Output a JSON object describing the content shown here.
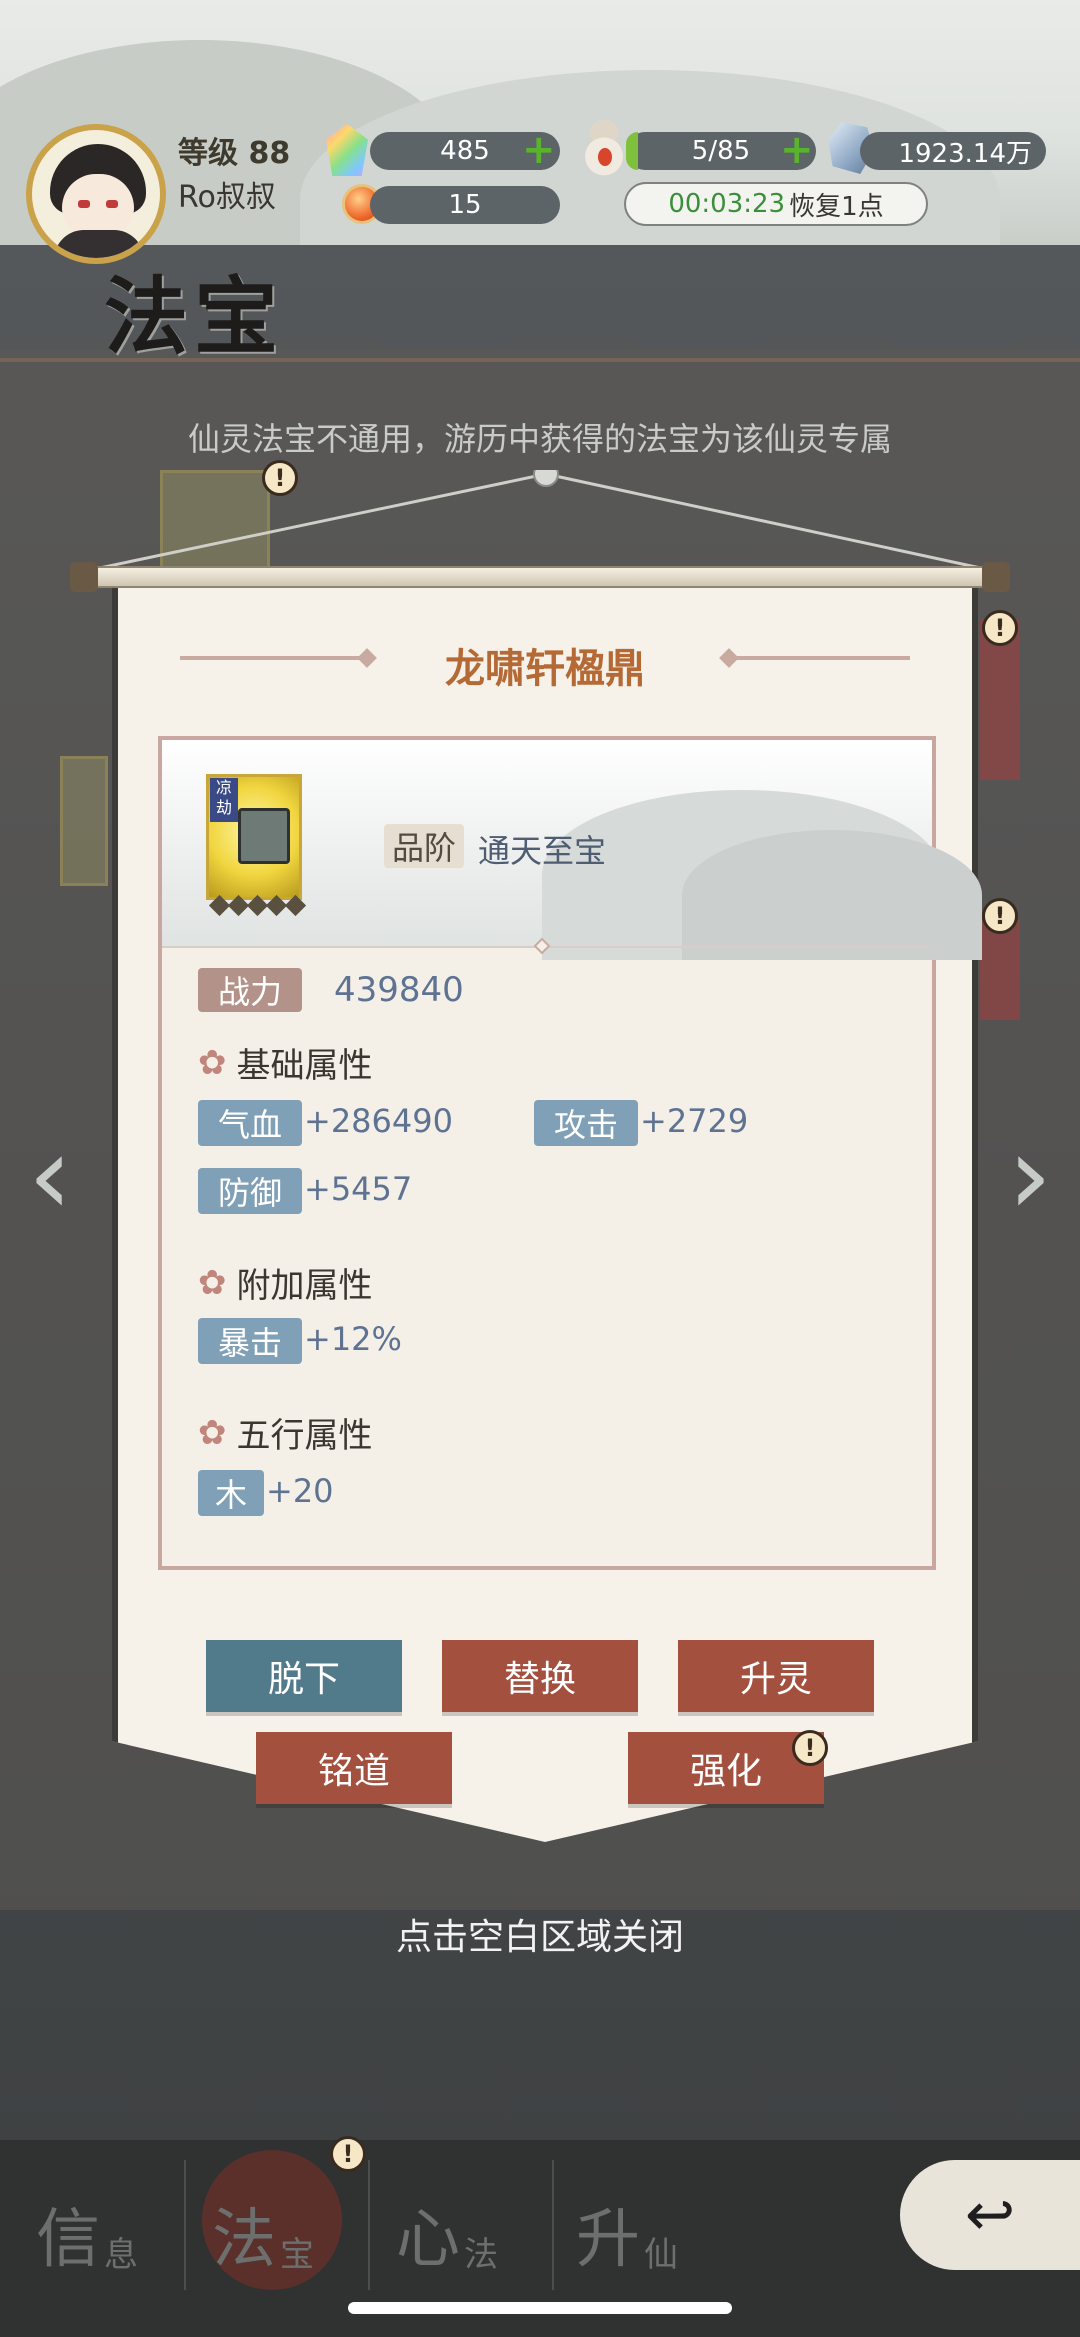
{
  "header": {
    "level_label": "等级",
    "level_value": "88",
    "player_name": "Ro叔叔",
    "gems": "485",
    "peaches": "15",
    "stamina": "5/85",
    "stamina_fraction": 0.06,
    "coins": "1923.14万",
    "timer": "00:03:23",
    "recover_label": "恢复1点"
  },
  "page": {
    "title": "法宝",
    "notice": "仙灵法宝不通用，游历中获得的法宝为该仙灵专属"
  },
  "detail": {
    "name": "龙啸轩楹鼎",
    "item_tag": "凉劫",
    "stars": 5,
    "grade_label": "品阶",
    "grade_value": "通天至宝",
    "power_label": "战力",
    "power_value": "439840",
    "base_section": "基础属性",
    "hp_label": "气血",
    "hp_value": "+286490",
    "atk_label": "攻击",
    "atk_value": "+2729",
    "def_label": "防御",
    "def_value": "+5457",
    "extra_section": "附加属性",
    "crit_label": "暴击",
    "crit_value": "+12%",
    "element_section": "五行属性",
    "wood_label": "木",
    "wood_value": "+20"
  },
  "buttons": {
    "remove": "脱下",
    "replace": "替换",
    "ascend": "升灵",
    "inscribe": "铭道",
    "enhance": "强化"
  },
  "close_hint": "点击空白区域关闭",
  "tabs": {
    "info_big": "信",
    "info_small": "息",
    "treasure_big": "法",
    "treasure_small": "宝",
    "heart_big": "心",
    "heart_small": "法",
    "ascend_big": "升",
    "ascend_small": "仙"
  },
  "badge_text": "!"
}
